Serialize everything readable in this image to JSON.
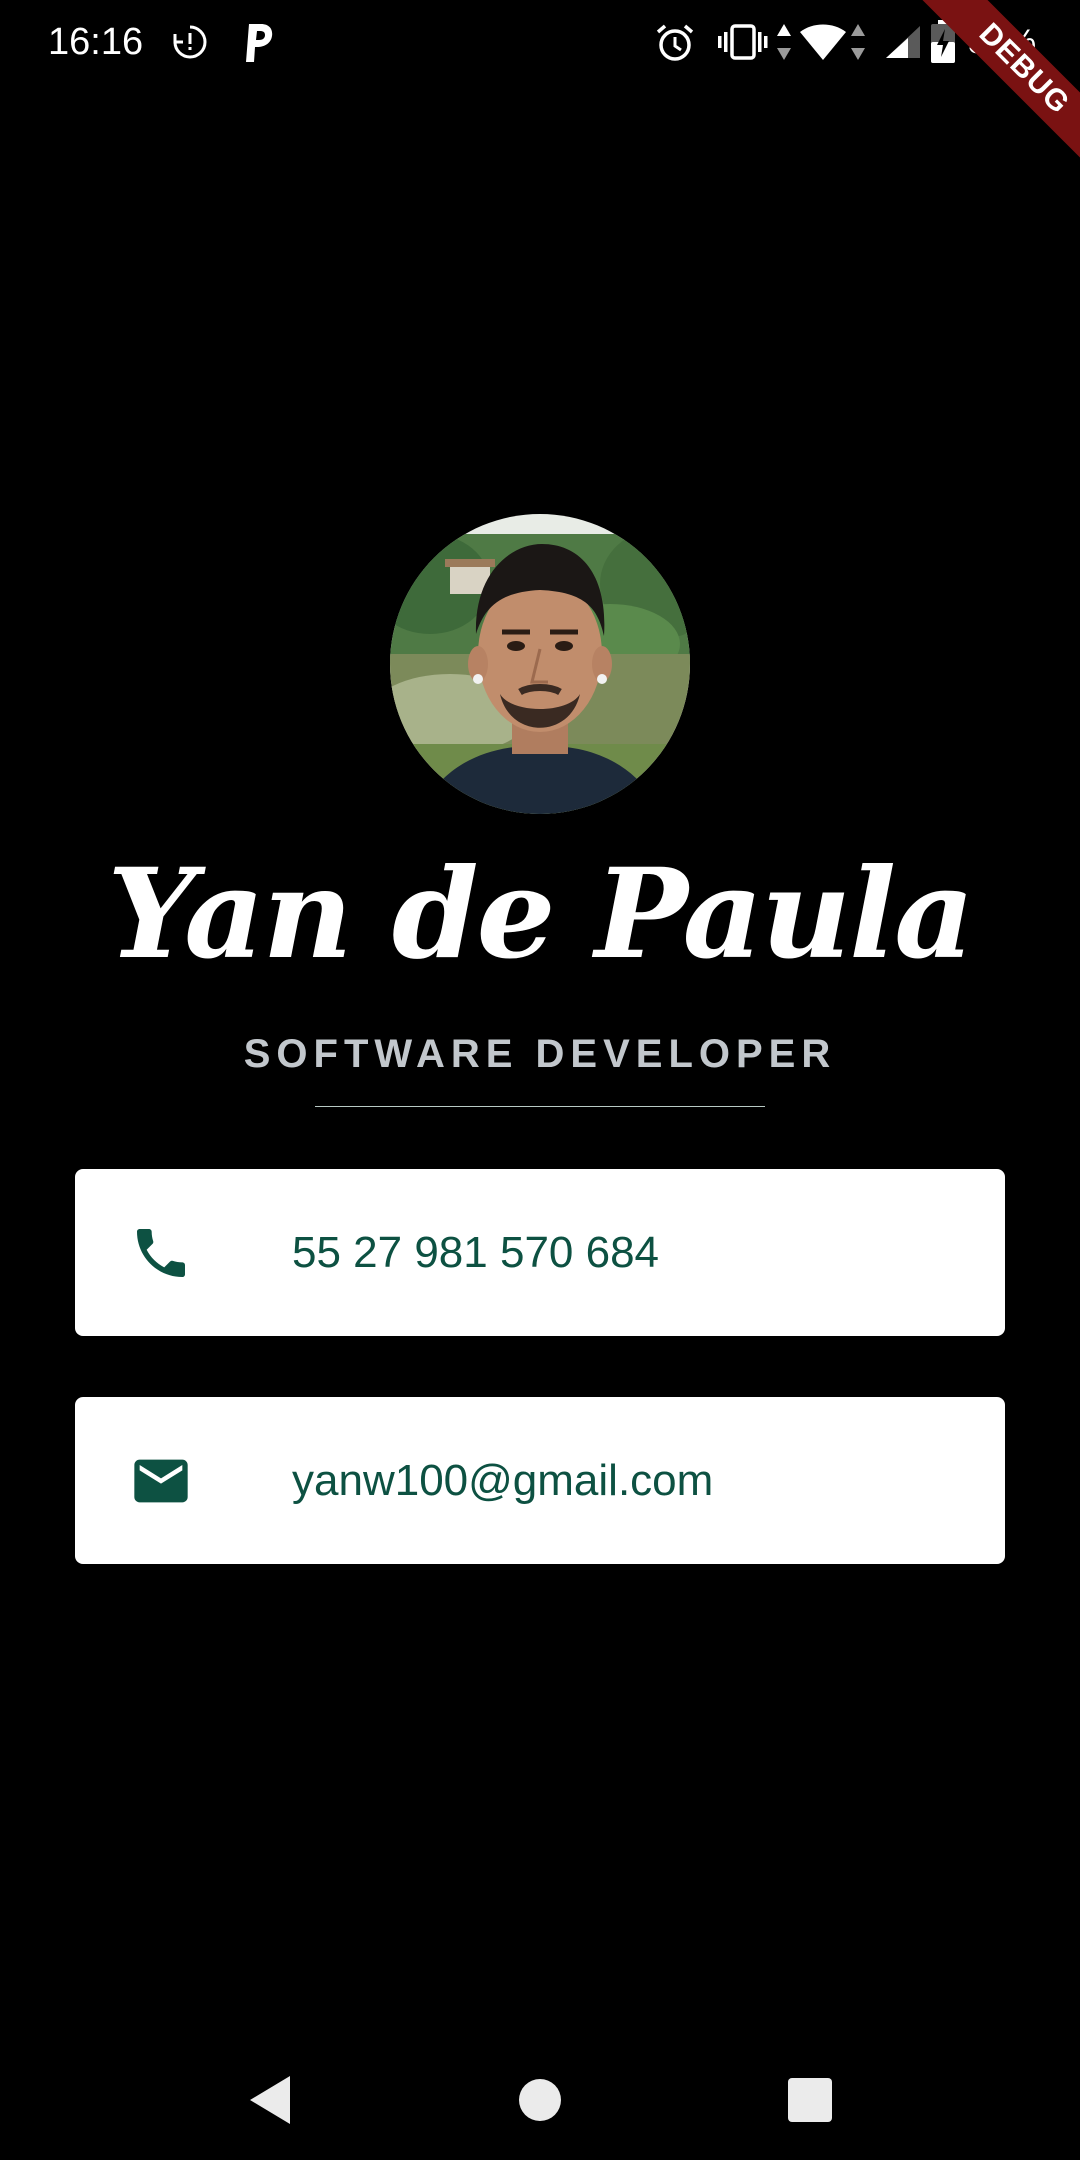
{
  "status_bar": {
    "time": "16:16",
    "battery_percent": "53%",
    "icons": [
      "sync-alert-icon",
      "parking-app-icon",
      "alarm-icon",
      "vibrate-icon",
      "data-arrows-icon",
      "wifi-icon",
      "cellular-signal-icon",
      "battery-charging-icon"
    ]
  },
  "debug_banner": {
    "label": "DEBUG",
    "color": "#7a1212"
  },
  "profile": {
    "avatar_icon": "profile-photo",
    "name": "Yan de Paula",
    "title": "SOFTWARE DEVELOPER"
  },
  "contacts": {
    "phone": {
      "icon": "phone-icon",
      "value": "55 27 981 570 684"
    },
    "email": {
      "icon": "mail-icon",
      "value": "yanw100@gmail.com"
    }
  },
  "colors": {
    "background": "#000000",
    "card_background": "#ffffff",
    "accent": "#0d5142",
    "subtitle": "#c2c7cc"
  },
  "navigation": {
    "buttons": [
      "back-icon",
      "home-icon",
      "recents-icon"
    ]
  }
}
